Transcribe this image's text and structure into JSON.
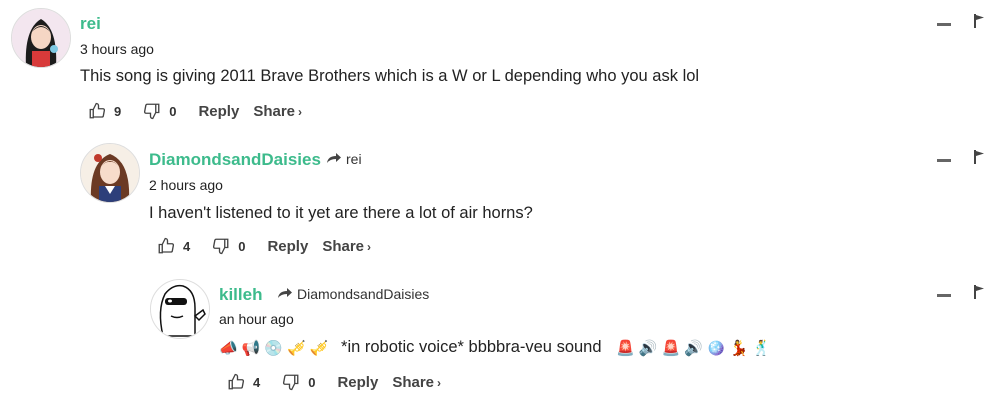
{
  "comments": [
    {
      "username": "rei",
      "reply_to": "",
      "time": "3 hours ago",
      "text": "This song is giving 2011 Brave Brothers which is a W or L depending who you ask lol",
      "upvotes": "9",
      "downvotes": "0",
      "reply_label": "Reply",
      "share_label": "Share"
    },
    {
      "username": "DiamondsandDaisies",
      "reply_to": "rei",
      "time": "2 hours ago",
      "text": "I haven't listened to it yet are there a lot of air horns?",
      "upvotes": "4",
      "downvotes": "0",
      "reply_label": "Reply",
      "share_label": "Share"
    },
    {
      "username": "killeh",
      "reply_to": "DiamondsandDaisies",
      "time": "an hour ago",
      "text": "*in robotic voice* bbbbra-veu sound",
      "upvotes": "4",
      "downvotes": "0",
      "reply_label": "Reply",
      "share_label": "Share",
      "leading_emojis": [
        "📣",
        "📢",
        "💿",
        "🎺",
        "🎺"
      ],
      "trailing_emojis": [
        "🚨",
        "🔊",
        "🚨",
        "🔊",
        "🪩",
        "💃",
        "🕺"
      ]
    }
  ],
  "colors": {
    "username": "#3dbb8c",
    "text": "#222222"
  }
}
